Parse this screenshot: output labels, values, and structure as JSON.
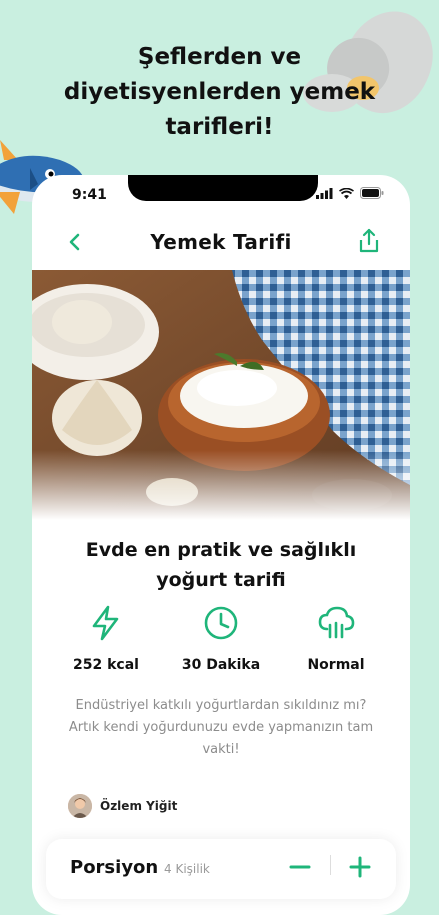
{
  "headline": {
    "line1": "Şeflerden ve",
    "line2": "diyetisyenlerden yemek",
    "line3": "tarifleri!"
  },
  "status_bar": {
    "time": "9:41"
  },
  "header": {
    "title": "Yemek  Tarifi"
  },
  "recipe": {
    "title_line1": "Evde en pratik ve sağlıklı",
    "title_line2": "yoğurt tarifi",
    "stats": [
      {
        "icon": "lightning-icon",
        "label": "252 kcal"
      },
      {
        "icon": "clock-icon",
        "label": "30 Dakika"
      },
      {
        "icon": "difficulty-icon",
        "label": "Normal"
      }
    ],
    "description": "Endüstriyel katkılı yoğurtlardan sıkıldınız mı? Artık kendi yoğurdunuzu evde yapmanızın tam vakti!",
    "author": "Özlem Yiğit"
  },
  "portion": {
    "label": "Porsiyon",
    "count": "4 Kişilik"
  },
  "colors": {
    "accent": "#1fb57a",
    "background": "#c9efe0"
  }
}
